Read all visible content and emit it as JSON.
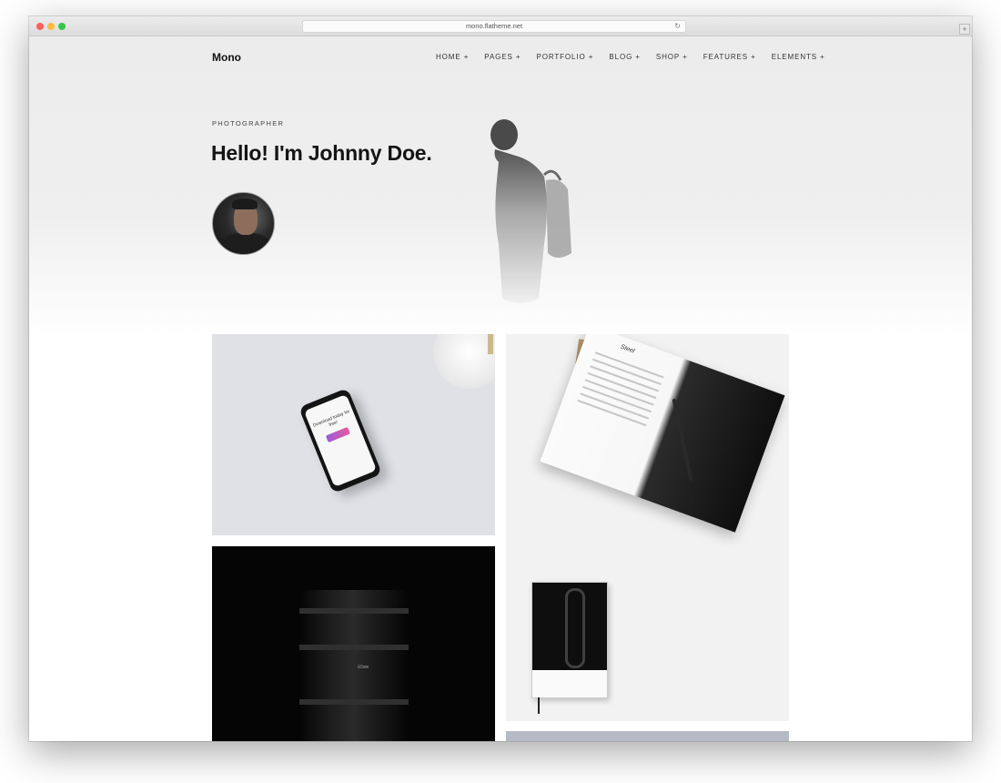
{
  "browser": {
    "url": "mono.flatheme.net",
    "reload_icon": "reload-icon",
    "new_tab_symbol": "+"
  },
  "site": {
    "logo": "Mono",
    "nav": [
      "HOME +",
      "PAGES +",
      "PORTFOLIO +",
      "BLOG +",
      "SHOP +",
      "FEATURES +",
      "ELEMENTS +"
    ]
  },
  "hero": {
    "eyebrow": "PHOTOGRAPHER",
    "headline": "Hello! I'm Johnny Doe."
  },
  "portfolio": {
    "phone_screen_text": "Download today for free!",
    "lens_text": "85mm",
    "book_heading": "Steel"
  },
  "colors": {
    "hero_bg": "#ececec",
    "text_dark": "#141414"
  }
}
